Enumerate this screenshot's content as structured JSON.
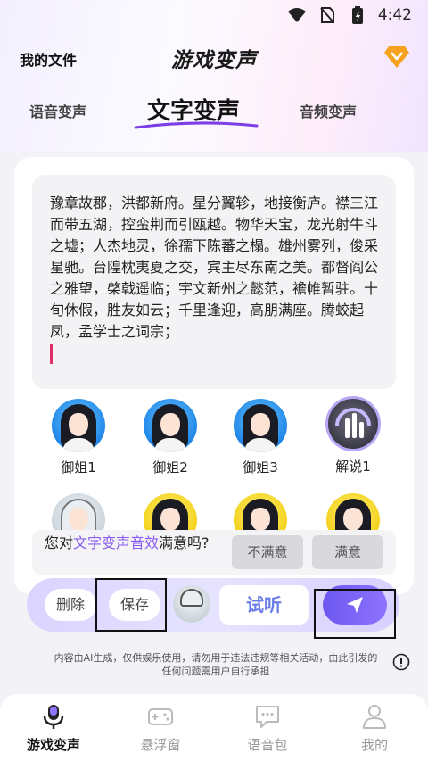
{
  "status_bar": {
    "time": "4:42"
  },
  "header": {
    "my_files": "我的文件",
    "title": "游戏变声"
  },
  "tabs": [
    {
      "label": "语音变声",
      "active": false
    },
    {
      "label": "文字变声",
      "active": true
    },
    {
      "label": "音频变声",
      "active": false
    }
  ],
  "editor": {
    "text": "豫章故郡，洪都新府。星分翼轸，地接衡庐。襟三江而带五湖，控蛮荆而引瓯越。物华天宝，龙光射牛斗之墟；人杰地灵，徐孺下陈蕃之榻。雄州雾列，俊采星驰。台隍枕夷夏之交，宾主尽东南之美。都督阎公之雅望，棨戟遥临；宇文新州之懿范，襜帷暂驻。十旬休假，胜友如云；千里逢迎，高朋满座。腾蛟起凤，孟学士之词宗；"
  },
  "voices": [
    {
      "label": "御姐1"
    },
    {
      "label": "御姐2"
    },
    {
      "label": "御姐3"
    },
    {
      "label": "解说1"
    }
  ],
  "satisfaction": {
    "prefix": "您对",
    "highlight": "文字变声音效",
    "suffix": "满意吗?",
    "no": "不满意",
    "yes": "满意"
  },
  "actions": {
    "delete": "删除",
    "save": "保存",
    "listen": "试听"
  },
  "disclaimer": "内容由AI生成，仅供娱乐使用，请勿用于违法违规等相关活动，由此引发的任何问题需用户自行承担",
  "bottom_nav": [
    {
      "label": "游戏变声",
      "icon": "mic-icon",
      "active": true
    },
    {
      "label": "悬浮窗",
      "icon": "gamepad-icon",
      "active": false
    },
    {
      "label": "语音包",
      "icon": "chat-bubble-icon",
      "active": false
    },
    {
      "label": "我的",
      "icon": "person-icon",
      "active": false
    }
  ],
  "colors": {
    "accent": "#8a5cf0",
    "send": "#6c57ef",
    "listen_text": "#6a7de8"
  }
}
